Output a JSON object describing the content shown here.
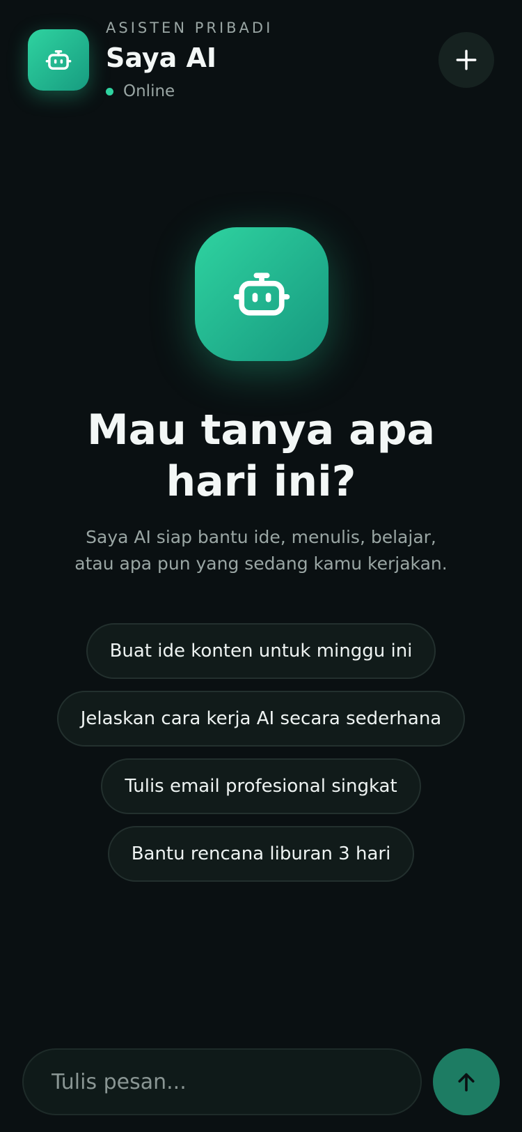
{
  "header": {
    "eyebrow": "ASISTEN PRIBADI",
    "title": "Saya AI",
    "status": "Online",
    "logo_icon": "robot-icon",
    "new_chat_icon": "plus-icon"
  },
  "hero": {
    "icon": "robot-icon",
    "title_line1": "Mau tanya apa",
    "title_line2": "hari ini?",
    "subtitle_line1": "Saya AI siap bantu ide, menulis, belajar,",
    "subtitle_line2": "atau apa pun yang sedang kamu kerjakan."
  },
  "suggestions": [
    "Buat ide konten untuk minggu ini",
    "Jelaskan cara kerja AI secara sederhana",
    "Tulis email profesional singkat",
    "Bantu rencana liburan 3 hari"
  ],
  "composer": {
    "placeholder": "Tulis pesan...",
    "send_icon": "arrow-up-icon"
  },
  "colors": {
    "background": "#0a1012",
    "accent": "#2fd3a0",
    "send_button": "#1d7c63",
    "chip_background": "#111b1a",
    "muted_text": "#9aa6a4"
  }
}
